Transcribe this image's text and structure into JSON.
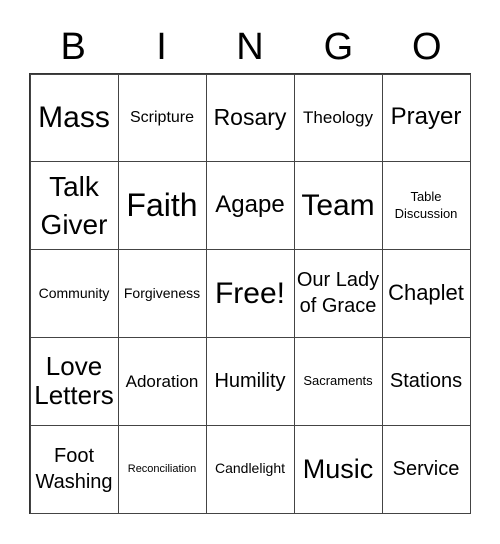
{
  "header": {
    "letters": [
      "B",
      "I",
      "N",
      "G",
      "O"
    ]
  },
  "grid": {
    "rows": [
      [
        "Mass",
        "Scripture",
        "Rosary",
        "Theology",
        "Prayer"
      ],
      [
        "Talk Giver",
        "Faith",
        "Agape",
        "Team",
        "Table Discussion"
      ],
      [
        "Community",
        "Forgiveness",
        "Free!",
        "Our Lady of Grace",
        "Chaplet"
      ],
      [
        "Love Letters",
        "Adoration",
        "Humility",
        "Sacraments",
        "Stations"
      ],
      [
        "Foot Washing",
        "Reconciliation",
        "Candlelight",
        "Music",
        "Service"
      ]
    ]
  }
}
